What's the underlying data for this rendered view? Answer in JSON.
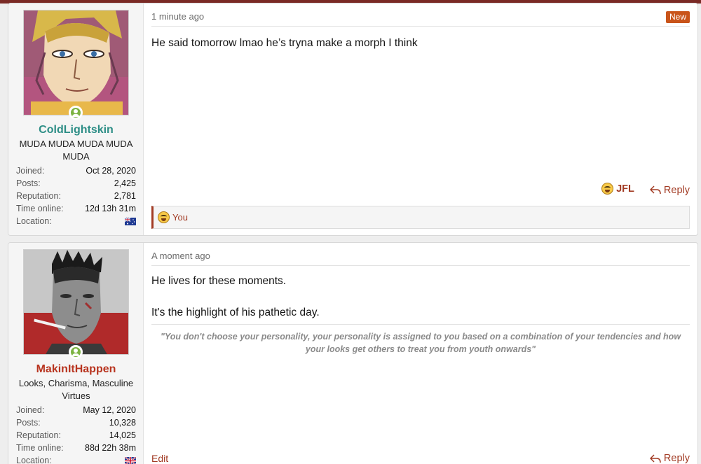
{
  "posts": [
    {
      "username": "ColdLightskin",
      "user_title": "MUDA MUDA MUDA MUDA MUDA",
      "avatar_icon": "anime-character-avatar",
      "stats": [
        {
          "label": "Joined:",
          "value": "Oct 28, 2020"
        },
        {
          "label": "Posts:",
          "value": "2,425"
        },
        {
          "label": "Reputation:",
          "value": "2,781"
        },
        {
          "label": "Time online:",
          "value": "12d 13h 31m"
        },
        {
          "label": "Location:",
          "value": ""
        }
      ],
      "location_flag": "australia-flag-icon",
      "timestamp": "1 minute ago",
      "badge": "New",
      "message": "He said tomorrow lmao he’s tryna make a morph I think",
      "reaction_label": "JFL",
      "reply_label": "Reply",
      "reaction_bar_text": "You"
    },
    {
      "username": "MakinItHappen",
      "user_title": "Looks, Charisma, Masculine Virtues",
      "avatar_icon": "smoking-man-avatar",
      "stats": [
        {
          "label": "Joined:",
          "value": "May 12, 2020"
        },
        {
          "label": "Posts:",
          "value": "10,328"
        },
        {
          "label": "Reputation:",
          "value": "14,025"
        },
        {
          "label": "Time online:",
          "value": "88d 22h 38m"
        },
        {
          "label": "Location:",
          "value": ""
        }
      ],
      "location_flag": "uk-flag-icon",
      "timestamp": "A moment ago",
      "message_paragraphs": [
        "He lives for these moments.",
        "It's the highlight of his pathetic day."
      ],
      "signature": "\"You don't choose your personality, your personality is assigned to you based on a combination of your tendencies and how your looks get others to treat you from youth onwards\"",
      "edit_label": "Edit",
      "reply_label": "Reply"
    }
  ],
  "colors": {
    "topbar": "#7a2a25",
    "accent": "#a23b24",
    "username1": "#2d8e86",
    "username2": "#b8341f",
    "new_badge": "#c9541a",
    "online": "#7cb342"
  }
}
